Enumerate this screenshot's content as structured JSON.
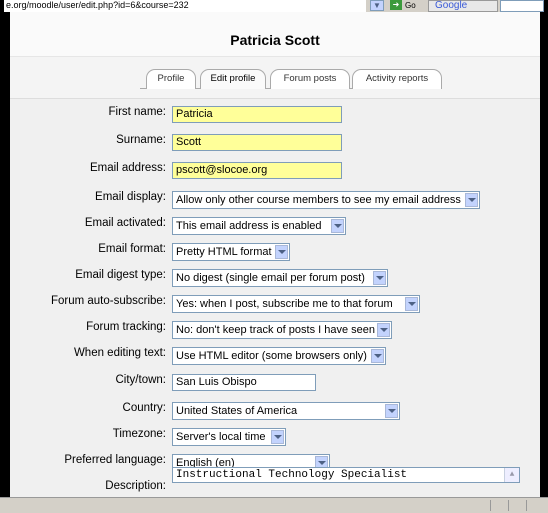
{
  "browser": {
    "url": "e.org/moodle/user/edit.php?id=6&course=232",
    "go_label": "Go",
    "search_logo": "Google"
  },
  "page": {
    "title": "Patricia Scott"
  },
  "tabs": [
    {
      "label": "Profile",
      "active": false
    },
    {
      "label": "Edit profile",
      "active": true
    },
    {
      "label": "Forum posts",
      "active": false
    },
    {
      "label": "Activity reports",
      "active": false
    }
  ],
  "form": {
    "first_name": {
      "label": "First name:",
      "value": "Patricia"
    },
    "surname": {
      "label": "Surname:",
      "value": "Scott"
    },
    "email": {
      "label": "Email address:",
      "value": "pscott@slocoe.org"
    },
    "email_display": {
      "label": "Email display:",
      "value": "Allow only other course members to see my email address"
    },
    "email_activated": {
      "label": "Email activated:",
      "value": "This email address is enabled"
    },
    "email_format": {
      "label": "Email format:",
      "value": "Pretty HTML format"
    },
    "email_digest": {
      "label": "Email digest type:",
      "value": "No digest (single email per forum post)"
    },
    "forum_autosubscribe": {
      "label": "Forum auto-subscribe:",
      "value": "Yes: when I post, subscribe me to that forum"
    },
    "forum_tracking": {
      "label": "Forum tracking:",
      "value": "No: don't keep track of posts I have seen"
    },
    "editing_text": {
      "label": "When editing text:",
      "value": "Use HTML editor (some browsers only)"
    },
    "city": {
      "label": "City/town:",
      "value": "San Luis Obispo"
    },
    "country": {
      "label": "Country:",
      "value": "United States of America"
    },
    "timezone": {
      "label": "Timezone:",
      "value": "Server's local time"
    },
    "language": {
      "label": "Preferred language:",
      "value": "English (en)"
    },
    "description": {
      "label": "Description:",
      "value": "Instructional Technology Specialist"
    }
  },
  "colors": {
    "required_field": "#ffff99",
    "form_background": "#f0f0f0",
    "select_arrow": "#c3d3fd"
  }
}
